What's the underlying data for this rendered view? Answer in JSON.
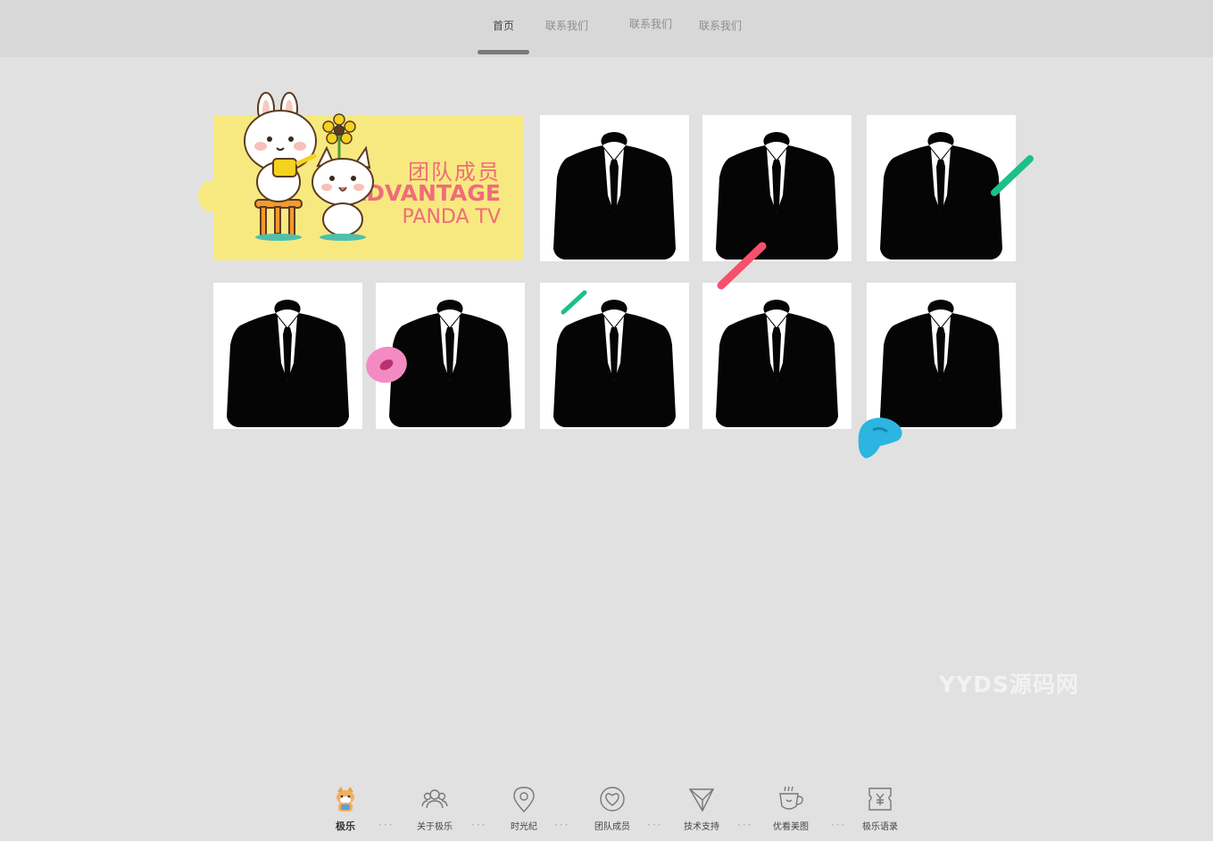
{
  "top_nav": {
    "items": [
      {
        "label": "首页",
        "active": true
      },
      {
        "label": "联系我们",
        "active": false
      },
      {
        "label": "联系我们",
        "active": false
      },
      {
        "label": "联系我们",
        "active": false
      }
    ]
  },
  "banner": {
    "title_cn": "团队成员",
    "title_en": "ADVANTAGE",
    "subtitle": "PANDA TV"
  },
  "watermark": "YYDS源码网",
  "bottom_nav": {
    "items": [
      {
        "label": "极乐",
        "icon": "shiba-dog-icon",
        "active": true
      },
      {
        "label": "关于极乐",
        "icon": "users-icon",
        "active": false
      },
      {
        "label": "时光纪",
        "icon": "location-pin-icon",
        "active": false
      },
      {
        "label": "团队成员",
        "icon": "heart-icon",
        "active": false
      },
      {
        "label": "技术支持",
        "icon": "paper-plane-icon",
        "active": false
      },
      {
        "label": "优看美图",
        "icon": "coffee-cup-icon",
        "active": false
      },
      {
        "label": "极乐语录",
        "icon": "yuan-ticket-icon",
        "active": false
      }
    ]
  },
  "colors": {
    "background": "#e1e1e1",
    "topbar": "#d8d8d8",
    "banner_yellow": "#f7e97f",
    "accent_pink": "#ef6c7a",
    "green": "#1dbf8a",
    "red": "#f6506c",
    "blue": "#2bb5e0"
  }
}
